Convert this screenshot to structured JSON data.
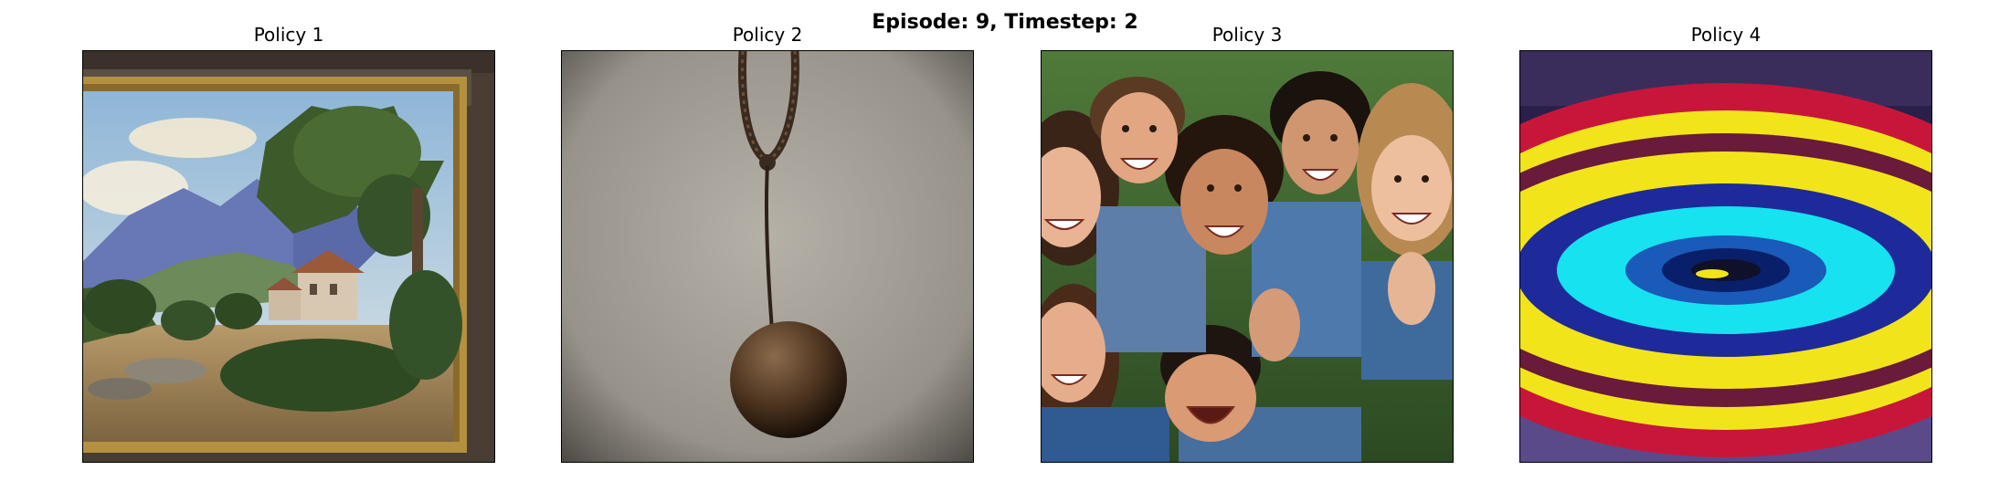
{
  "figure": {
    "suptitle": "Episode: 9, Timestep: 2"
  },
  "panels": [
    {
      "title": "Policy 1",
      "image": "landscape-painting-with-villa-and-mountains"
    },
    {
      "title": "Policy 2",
      "image": "sphere-hanging-on-rope"
    },
    {
      "title": "Policy 3",
      "image": "group-of-laughing-people"
    },
    {
      "title": "Policy 4",
      "image": "concentric-colored-rings"
    }
  ]
}
